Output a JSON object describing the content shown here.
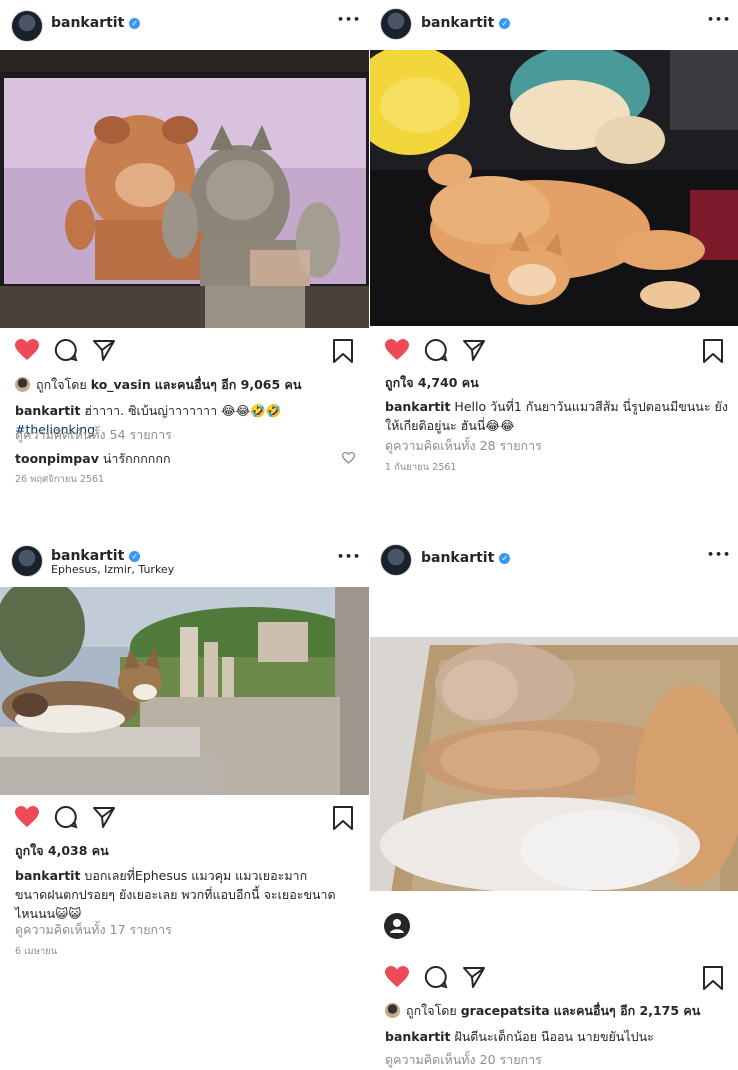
{
  "posts": [
    {
      "username": "bankartit",
      "location": "",
      "likes_prefix": "ถูกใจโดย",
      "likes_user": "ko_vasin",
      "likes_suffix": "และคนอื่นๆ อีก 9,065 คน",
      "caption_text": "ฮ่าาาา. ซิเบ้นญ่าาาาาาา 😂😂🤣🤣",
      "caption_tag": "#thelionking",
      "comments_count": "ดูความคิดเห็นทั้ง 54 รายการ",
      "comment_user": "toonpimpav",
      "comment_text": "น่ารักกกกกก",
      "date": "26 พฤศจิกายน 2561"
    },
    {
      "username": "bankartit",
      "likes_text": "ถูกใจ 4,740 คน",
      "caption_text": "Hello วันที่1 กันยาวันแมวสีส้ม นี่รูปตอนมีขนนะ ยังให้เกียติอยู่นะ ฮันนี่😂😂",
      "comments_count": "ดูความคิดเห็นทั้ง 28 รายการ",
      "date": "1 กันยายน 2561"
    },
    {
      "username": "bankartit",
      "location": "Ephesus, Izmir, Turkey",
      "likes_text": "ถูกใจ 4,038 คน",
      "caption_text": "บอกเลยที่Ephesus แมวคุม แมวเยอะมาก ขนาดฝนตกปรอยๆ ยังเยอะเลย พวกที่แอบอีกนี้ จะเยอะขนาดไหนนน😺😺",
      "comments_count": "ดูความคิดเห็นทั้ง 17 รายการ",
      "date": "6 เมษายน"
    },
    {
      "username": "bankartit",
      "likes_prefix": "ถูกใจโดย",
      "likes_user": "gracepatsita",
      "likes_suffix": "และคนอื่นๆ อีก 2,175 คน",
      "caption_text": "ฝันดีนะเด็กน้อย นีออน นายขยันไปนะ",
      "comments_count": "ดูความคิดเห็นทั้ง 20 รายการ"
    }
  ],
  "icons": {
    "more": "•••",
    "verified": "✓"
  },
  "colors": {
    "heart": "#ed4956",
    "verified": "#3897f0",
    "hashtag": "#003569",
    "muted": "#8e8e8e"
  }
}
